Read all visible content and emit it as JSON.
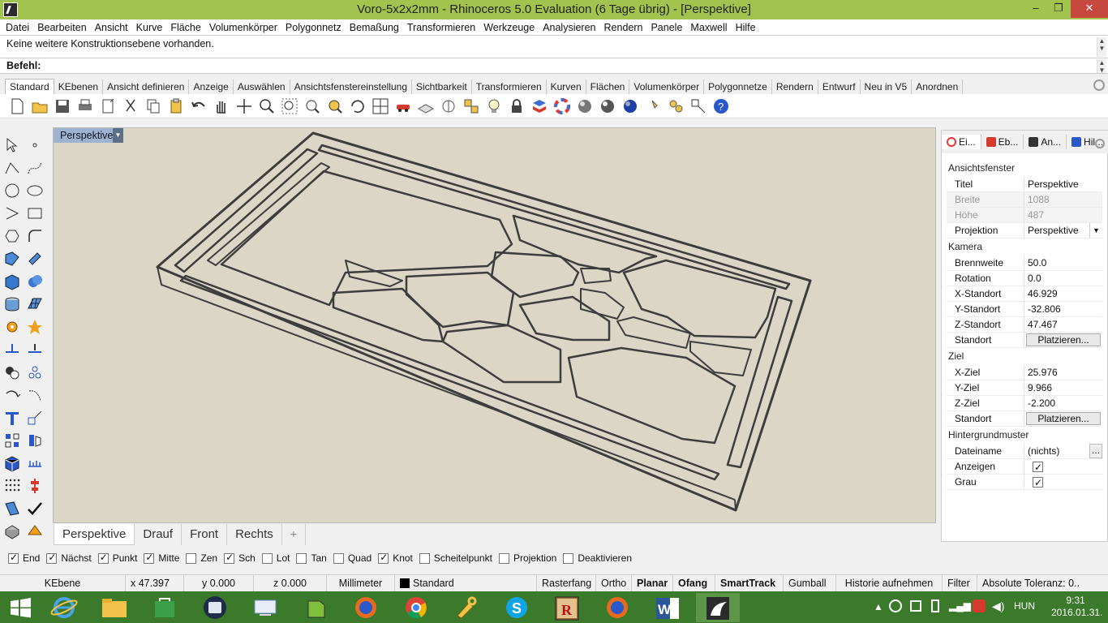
{
  "window": {
    "title": "Voro-5x2x2mm - Rhinoceros 5.0 Evaluation (6 Tage übrig) - [Perspektive]",
    "minimize": "–",
    "maximize": "❐",
    "close": "✕"
  },
  "menu": [
    "Datei",
    "Bearbeiten",
    "Ansicht",
    "Kurve",
    "Fläche",
    "Volumenkörper",
    "Polygonnetz",
    "Bemaßung",
    "Transformieren",
    "Werkzeuge",
    "Analysieren",
    "Rendern",
    "Panele",
    "Maxwell",
    "Hilfe"
  ],
  "command": {
    "history": "Keine weitere Konstruktionsebene vorhanden.",
    "prompt": "Befehl:"
  },
  "toolbar_tabs": [
    "Standard",
    "KEbenen",
    "Ansicht definieren",
    "Anzeige",
    "Auswählen",
    "Ansichtsfenstereinstellung",
    "Sichtbarkeit",
    "Transformieren",
    "Kurven",
    "Flächen",
    "Volumenkörper",
    "Polygonnetze",
    "Rendern",
    "Entwurf",
    "Neu in V5",
    "Anordnen"
  ],
  "viewport": {
    "title": "Perspektive"
  },
  "viewport_tabs": [
    "Perspektive",
    "Drauf",
    "Front",
    "Rechts"
  ],
  "viewport_add": "+",
  "osnaps": [
    {
      "label": "End",
      "checked": true
    },
    {
      "label": "Nächst",
      "checked": true
    },
    {
      "label": "Punkt",
      "checked": true
    },
    {
      "label": "Mitte",
      "checked": true
    },
    {
      "label": "Zen",
      "checked": false
    },
    {
      "label": "Sch",
      "checked": true
    },
    {
      "label": "Lot",
      "checked": false
    },
    {
      "label": "Tan",
      "checked": false
    },
    {
      "label": "Quad",
      "checked": false
    },
    {
      "label": "Knot",
      "checked": true
    },
    {
      "label": "Scheitelpunkt",
      "checked": false
    },
    {
      "label": "Projektion",
      "checked": false
    },
    {
      "label": "Deaktivieren",
      "checked": false
    }
  ],
  "status": {
    "cplane": "KEbene",
    "x": "x 47.397",
    "y": "y 0.000",
    "z": "z 0.000",
    "units": "Millimeter",
    "layer": "Standard",
    "grid_snap": "Rasterfang",
    "ortho": "Ortho",
    "planar": "Planar",
    "osnap": "Ofang",
    "smarttrack": "SmartTrack",
    "gumball": "Gumball",
    "history": "Historie aufnehmen",
    "filter": "Filter",
    "tolerance": "Absolute Toleranz: 0..."
  },
  "panel": {
    "tabs": [
      "Ei...",
      "Eb...",
      "An...",
      "Hil..."
    ],
    "section_viewport": "Ansichtsfenster",
    "titel_label": "Titel",
    "titel_value": "Perspektive",
    "breite_label": "Breite",
    "breite_value": "1088",
    "hoehe_label": "Höhe",
    "hoehe_value": "487",
    "projektion_label": "Projektion",
    "projektion_value": "Perspektive",
    "section_camera": "Kamera",
    "brennweite_label": "Brennweite",
    "brennweite_value": "50.0",
    "rotation_label": "Rotation",
    "rotation_value": "0.0",
    "xstandort_label": "X-Standort",
    "xstandort_value": "46.929",
    "ystandort_label": "Y-Standort",
    "ystandort_value": "-32.806",
    "zstandort_label": "Z-Standort",
    "zstandort_value": "47.467",
    "standort_label": "Standort",
    "platzieren": "Platzieren...",
    "section_target": "Ziel",
    "xziel_label": "X-Ziel",
    "xziel_value": "25.976",
    "yziel_label": "Y-Ziel",
    "yziel_value": "9.966",
    "zziel_label": "Z-Ziel",
    "zziel_value": "-2.200",
    "section_bg": "Hintergrundmuster",
    "dateiname_label": "Dateiname",
    "dateiname_value": "(nichts)",
    "dots": "...",
    "anzeigen_label": "Anzeigen",
    "grau_label": "Grau"
  },
  "taskbar": {
    "language": "HUN",
    "time": "9:31",
    "date": "2016.01.31."
  },
  "colors": {
    "titlebar": "#a2c44e",
    "taskbar": "#3c7a2b",
    "viewport_bg": "#dcd6c6",
    "close": "#c7483f"
  }
}
